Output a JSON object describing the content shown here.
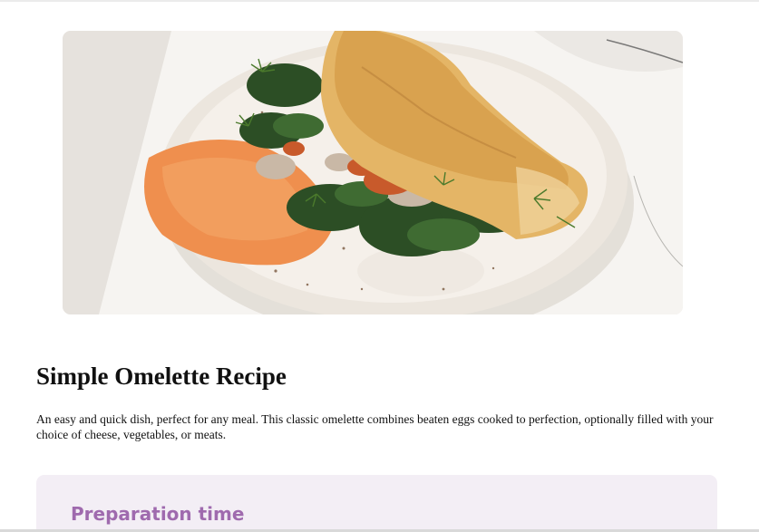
{
  "recipe": {
    "hero_image": "omelette-with-spinach-and-hummus-photo",
    "title": "Simple Omelette Recipe",
    "description": "An easy and quick dish, perfect for any meal. This classic omelette combines beaten eggs cooked to perfection, optionally filled with your choice of cheese, vegetables, or meats."
  },
  "preparation": {
    "heading": "Preparation time"
  },
  "colors": {
    "page_background": "#ffffff",
    "prep_card_background": "#f3eef5",
    "prep_heading": "#9f6aae",
    "text": "#111111"
  }
}
